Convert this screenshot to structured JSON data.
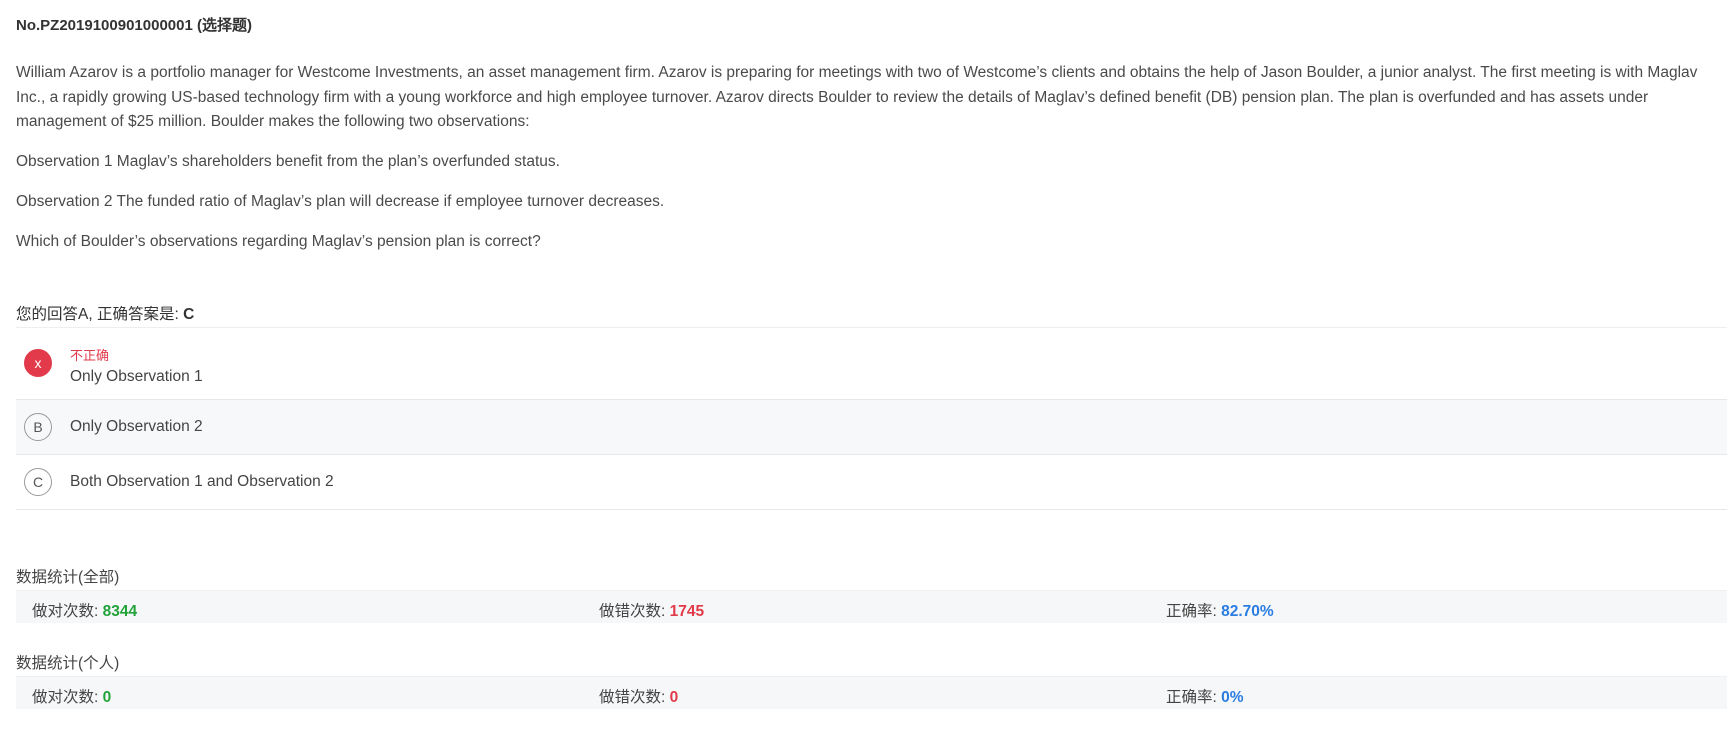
{
  "question": {
    "id": "No.PZ2019100901000001 (选择题)",
    "stem": [
      "William Azarov is a portfolio manager for Westcome Investments, an asset management firm. Azarov is preparing for meetings with two of Westcome’s clients and obtains the help of Jason Boulder, a junior analyst. The first meeting is with Maglav Inc., a rapidly growing US-based technology firm with a young workforce and high employee turnover. Azarov directs Boulder to review the details of Maglav’s defined benefit (DB) pension plan. The plan is overfunded and has assets under management of $25 million. Boulder makes the following two observations:",
      "Observation 1 Maglav’s shareholders benefit from the plan’s overfunded status.",
      "Observation 2 The funded ratio of Maglav’s plan will decrease if employee turnover decreases.",
      "Which of Boulder’s observations regarding Maglav’s pension plan is correct?"
    ]
  },
  "answer": {
    "prefix": "您的回答A, 正确答案是: ",
    "correct": "C"
  },
  "options": [
    {
      "badge": "x",
      "status": "不正确",
      "text": "Only Observation 1"
    },
    {
      "badge": "B",
      "text": "Only Observation 2"
    },
    {
      "badge": "C",
      "text": "Both Observation 1 and Observation 2"
    }
  ],
  "stats_all": {
    "title": "数据统计(全部)",
    "correct_label": "做对次数: ",
    "correct_value": "8344",
    "wrong_label": "做错次数: ",
    "wrong_value": "1745",
    "rate_label": "正确率: ",
    "rate_value": "82.70%"
  },
  "stats_personal": {
    "title": "数据统计(个人)",
    "correct_label": "做对次数: ",
    "correct_value": "0",
    "wrong_label": "做错次数: ",
    "wrong_value": "0",
    "rate_label": "正确率: ",
    "rate_value": "0%"
  },
  "colors": {
    "correct": "#22a33a",
    "wrong": "#e23a4a",
    "rate": "#2a7de1"
  }
}
